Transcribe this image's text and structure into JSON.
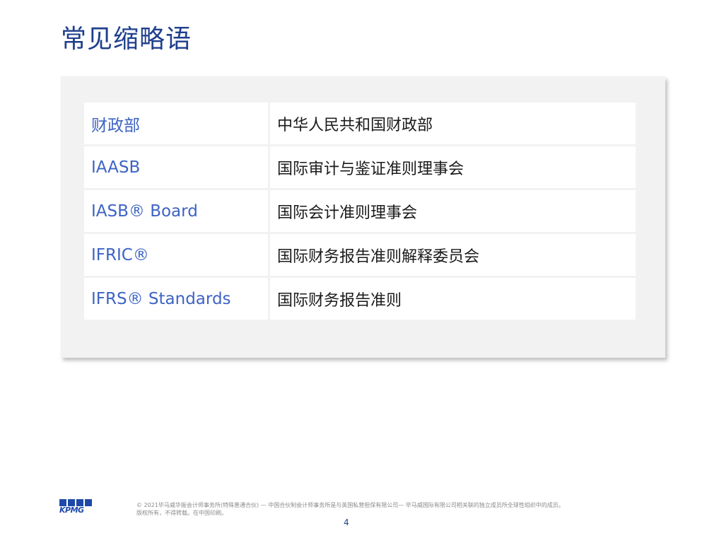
{
  "header": {
    "title": "常见缩略语"
  },
  "abbreviations": [
    {
      "term": "财政部",
      "meaning": "中华人民共和国财政部"
    },
    {
      "term": "IAASB",
      "meaning": "国际审计与鉴证准则理事会"
    },
    {
      "term": "IASB® Board",
      "meaning": "国际会计准则理事会"
    },
    {
      "term": "IFRIC®",
      "meaning": "国际财务报告准则解释委员会"
    },
    {
      "term": "IFRS® Standards",
      "meaning": "国际财务报告准则"
    }
  ],
  "footer": {
    "logo_text": "KPMG",
    "copyright_line1": "© 2021毕马威华振会计师事务所(特殊普通合伙) — 中国合伙制会计师事务所是与英国私营担保有限公司— 毕马威国际有限公司相关联的独立成员所全球性组织中的成员。",
    "copyright_line2": "版权所有，不得转载。在中国印刷。",
    "page_number": "4"
  },
  "colors": {
    "title": "#1e3f8c",
    "term": "#3d63c4",
    "panel": "#f2f2f2",
    "logo": "#1e49a8"
  }
}
